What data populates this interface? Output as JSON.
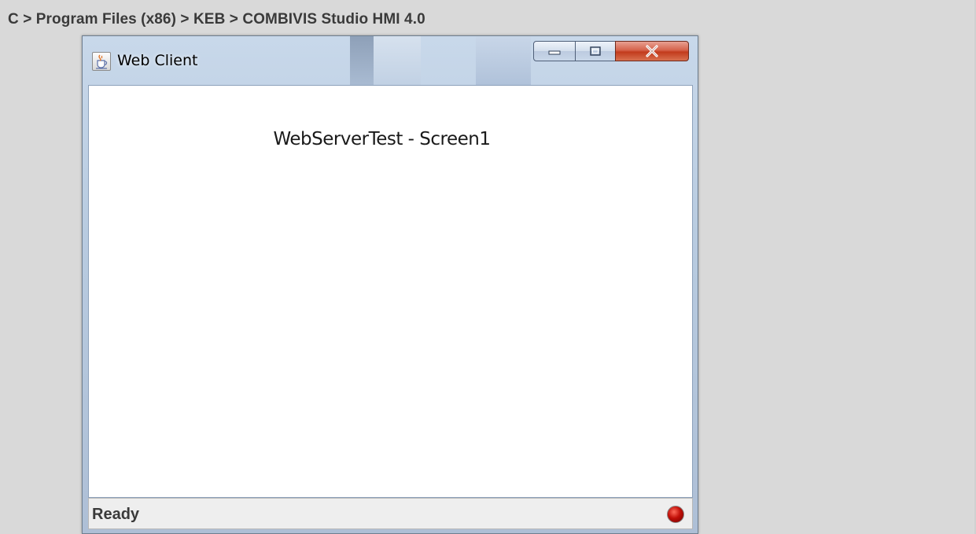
{
  "breadcrumb": {
    "path": "C > Program Files (x86) > KEB > COMBIVIS Studio HMI 4.0"
  },
  "window": {
    "title": "Web Client",
    "icon": "java-cup-icon",
    "controls": {
      "minimize": "minimize-icon",
      "maximize": "maximize-icon",
      "close": "close-icon"
    }
  },
  "client": {
    "screen_title": "WebServerTest - Screen1"
  },
  "status_bar": {
    "text": "Ready",
    "indicator_color": "#c10f08"
  },
  "colors": {
    "background": "#d9d9d9",
    "close_button": "#c23a1c"
  }
}
